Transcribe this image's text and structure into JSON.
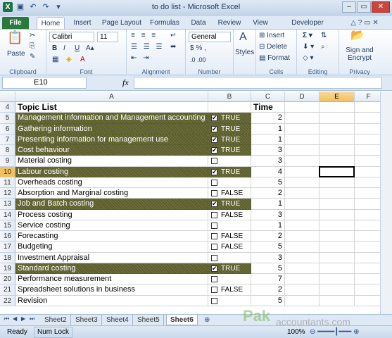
{
  "window": {
    "title": "to do list - Microsoft Excel"
  },
  "ribbon_tabs": [
    "File",
    "Home",
    "Insert",
    "Page Layout",
    "Formulas",
    "Data",
    "Review",
    "View",
    "Developer"
  ],
  "ribbon": {
    "paste": "Paste",
    "font_name": "Calibri",
    "font_size": "11",
    "number_format": "General",
    "styles": "Styles",
    "insert": "Insert",
    "delete": "Delete",
    "format": "Format",
    "sign": "Sign and",
    "encrypt": "Encrypt",
    "groups": {
      "clipboard": "Clipboard",
      "font": "Font",
      "alignment": "Alignment",
      "number": "Number",
      "cells": "Cells",
      "editing": "Editing",
      "privacy": "Privacy"
    }
  },
  "formula_bar": {
    "name_box": "E10",
    "fx": "fx",
    "formula": ""
  },
  "columns": [
    "A",
    "B",
    "C",
    "D",
    "E",
    "F"
  ],
  "header_row": {
    "row": "4",
    "a": "Topic List",
    "c": "Time"
  },
  "rows": [
    {
      "row": "5",
      "topic": "Management information and Management accounting",
      "checked": true,
      "status": "TRUE",
      "time": "2"
    },
    {
      "row": "6",
      "topic": "Gathering information",
      "checked": true,
      "status": "TRUE",
      "time": "1"
    },
    {
      "row": "7",
      "topic": "Presenting information for management use",
      "checked": true,
      "status": "TRUE",
      "time": "1"
    },
    {
      "row": "8",
      "topic": "Cost behaviour",
      "checked": true,
      "status": "TRUE",
      "time": "3"
    },
    {
      "row": "9",
      "topic": "Material costing",
      "checked": false,
      "status": "",
      "time": "3"
    },
    {
      "row": "10",
      "topic": "Labour costing",
      "checked": true,
      "status": "TRUE",
      "time": "4"
    },
    {
      "row": "11",
      "topic": "Overheads costing",
      "checked": false,
      "status": "",
      "time": "5"
    },
    {
      "row": "12",
      "topic": "Absorption and Marginal costing",
      "checked": false,
      "status": "FALSE",
      "time": "2"
    },
    {
      "row": "13",
      "topic": "Job and Batch costing",
      "checked": true,
      "status": "TRUE",
      "time": "1"
    },
    {
      "row": "14",
      "topic": "Process costing",
      "checked": false,
      "status": "FALSE",
      "time": "3"
    },
    {
      "row": "15",
      "topic": "Service costing",
      "checked": false,
      "status": "",
      "time": "1"
    },
    {
      "row": "16",
      "topic": "Forecasting",
      "checked": false,
      "status": "FALSE",
      "time": "2"
    },
    {
      "row": "17",
      "topic": "Budgeting",
      "checked": false,
      "status": "FALSE",
      "time": "5"
    },
    {
      "row": "18",
      "topic": "Investment Appraisal",
      "checked": false,
      "status": "",
      "time": "3"
    },
    {
      "row": "19",
      "topic": "Standard costing",
      "checked": true,
      "status": "TRUE",
      "time": "5"
    },
    {
      "row": "20",
      "topic": "Performance measurement",
      "checked": false,
      "status": "",
      "time": "7"
    },
    {
      "row": "21",
      "topic": "Spreadsheet solutions in business",
      "checked": false,
      "status": "FALSE",
      "time": "2"
    },
    {
      "row": "22",
      "topic": "Revision",
      "checked": false,
      "status": "",
      "time": "5"
    }
  ],
  "sheet_tabs": [
    "Sheet2",
    "Sheet3",
    "Sheet4",
    "Sheet5",
    "Sheet6"
  ],
  "active_sheet": "Sheet6",
  "status_bar": {
    "ready": "Ready",
    "num_lock": "Num Lock",
    "zoom": "100%"
  },
  "watermark": {
    "brand": "Pak",
    "site": "accountants.com"
  },
  "colors": {
    "highlight": "#5c5f2c",
    "excel_green": "#1e7145",
    "selected_header": "#f1c15f"
  }
}
